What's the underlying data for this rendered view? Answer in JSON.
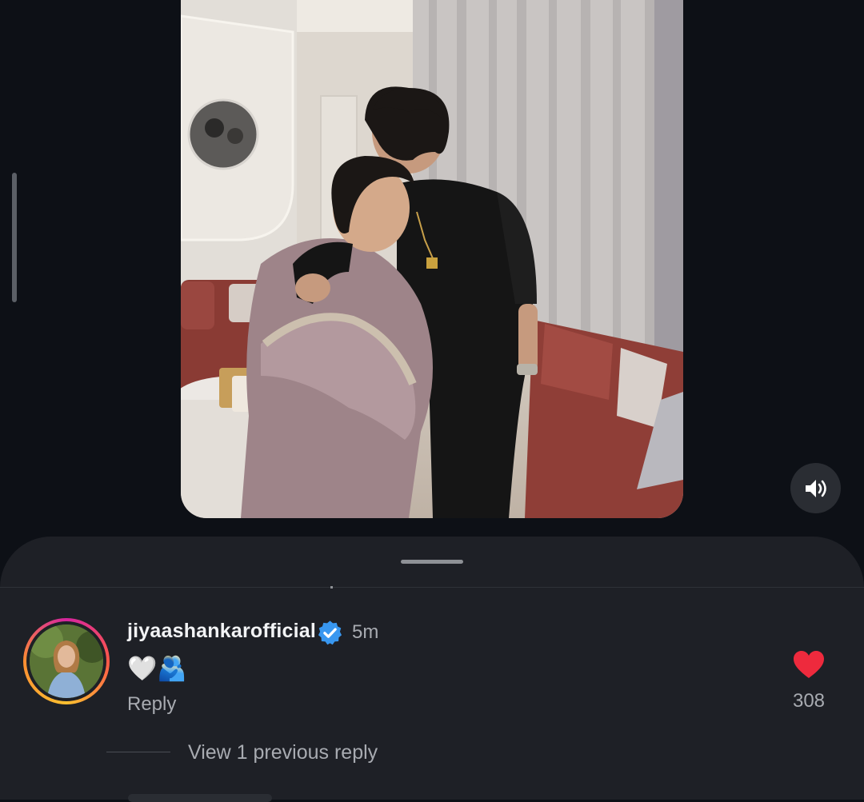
{
  "reel": {
    "sound_icon": "speaker-volume-icon"
  },
  "comment": {
    "username": "jiyaashankarofficial",
    "verified_icon": "verified-badge-icon",
    "time": "5m",
    "text": "🤍🫂",
    "reply_label": "Reply",
    "like_icon": "heart-filled-icon",
    "like_count": "308",
    "view_replies_label": "View 1 previous reply"
  },
  "colors": {
    "background": "#0d1016",
    "sheet": "#1e2026",
    "like": "#ee2a3d",
    "verified": "#3897f0",
    "secondary_text": "#a8abb1"
  }
}
